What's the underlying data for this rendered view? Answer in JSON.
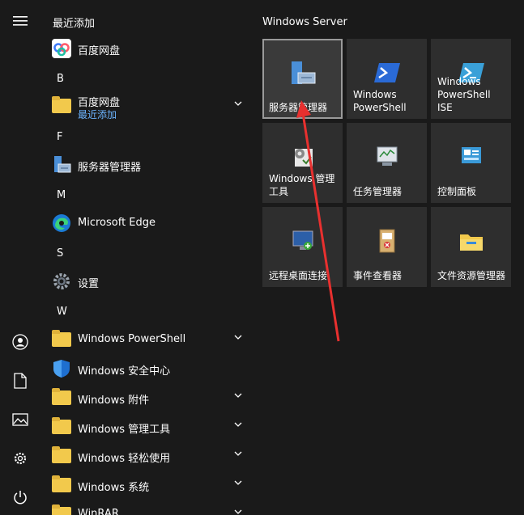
{
  "list": {
    "recent_header": "最近添加",
    "recent_item": "百度网盘",
    "letters": [
      "B",
      "F",
      "M",
      "S",
      "W"
    ],
    "b_folder": {
      "label": "百度网盘",
      "sub": "最近添加"
    },
    "f_item": "服务器管理器",
    "m_item": "Microsoft Edge",
    "s_item": "设置",
    "w_items": [
      "Windows PowerShell",
      "Windows 安全中心",
      "Windows 附件",
      "Windows 管理工具",
      "Windows 轻松使用",
      "Windows 系统",
      "WinRAR"
    ]
  },
  "tiles": {
    "group_title": "Windows Server",
    "labels": [
      "服务器管理器",
      "Windows PowerShell",
      "Windows PowerShell ISE",
      "Windows 管理工具",
      "任务管理器",
      "控制面板",
      "远程桌面连接",
      "事件查看器",
      "文件资源管理器"
    ],
    "label_lines": [
      [
        "服务器管理器"
      ],
      [
        "Windows",
        "PowerShell"
      ],
      [
        "Windows",
        "PowerShell ISE"
      ],
      [
        "Windows 管理",
        "工具"
      ],
      [
        "任务管理器"
      ],
      [
        "控制面板"
      ],
      [
        "远程桌面连接"
      ],
      [
        "事件查看器"
      ],
      [
        "文件资源管理器"
      ]
    ]
  },
  "colors": {
    "accent": "#0078d4",
    "annotation": "#e8302f",
    "folder": "#f2c94c"
  }
}
